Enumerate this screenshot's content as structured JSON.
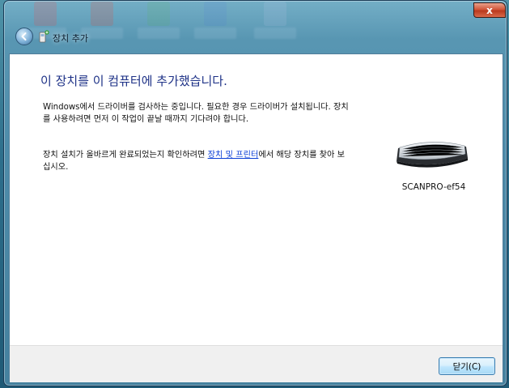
{
  "window": {
    "title": "장치 추가",
    "close_glyph": "x"
  },
  "content": {
    "heading": "이 장치를 이 컴퓨터에 추가했습니다.",
    "paragraph1": "Windows에서 드라이버를 검사하는 중입니다. 필요한 경우 드라이버가 설치됩니다. 장치를 사용하려면 먼저 이 작업이 끝날 때까지 기다려야 합니다.",
    "paragraph2_before": "장치 설치가 올바르게 완료되었는지 확인하려면 ",
    "paragraph2_link": "장치 및 프린터",
    "paragraph2_after": "에서 해당 장치를 찾아 보십시오."
  },
  "device": {
    "name": "SCANPRO-ef54",
    "icon": "keyboard-icon"
  },
  "footer": {
    "close_button_label": "닫기(C)"
  },
  "icons": {
    "back": "back-arrow-icon",
    "title": "device-add-icon",
    "close": "close-icon"
  },
  "colors": {
    "heading": "#1e3287",
    "link": "#0b3fd6",
    "close_button_red": "#c8452a"
  }
}
